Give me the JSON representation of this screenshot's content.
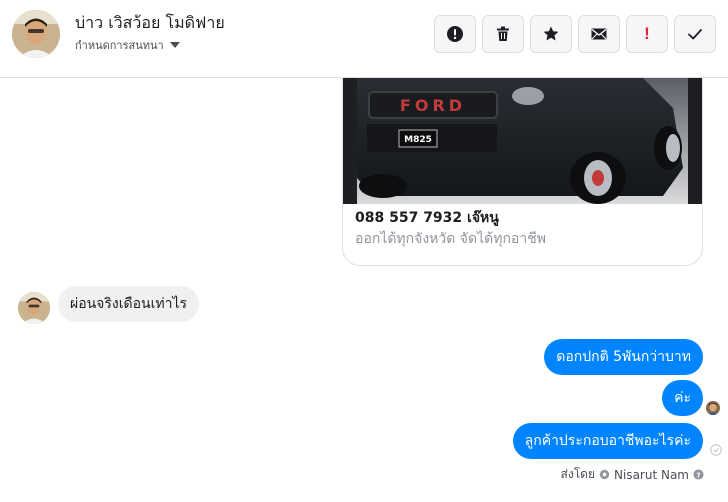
{
  "header": {
    "name": "บ่าว เวิสว้อย โมดิฟาย",
    "subtitle": "กำหนดการสนทนา",
    "actions": [
      {
        "name": "report-icon"
      },
      {
        "name": "trash-icon"
      },
      {
        "name": "star-icon"
      },
      {
        "name": "envelope-icon"
      },
      {
        "name": "important-icon",
        "label": "!"
      },
      {
        "name": "checkmark-icon"
      }
    ]
  },
  "conversation": {
    "card": {
      "title": "088 557 7932 เจ๊หนู",
      "description": "ออกได้ทุกจังหวัด จัดได้ทุกอาชีพ",
      "plate": "M825"
    },
    "messages": [
      {
        "direction": "in",
        "text": "ผ่อนจริงเดือนเท่าไร"
      },
      {
        "direction": "out",
        "text": "ดอกปกติ 5พันกว่าบาท"
      },
      {
        "direction": "out",
        "text": "ค่ะ"
      },
      {
        "direction": "out",
        "text": "ลูกค้าประกอบอาชีพอะไรค่ะ"
      }
    ],
    "sent_by": {
      "label": "ส่งโดย",
      "sender": "Nisarut Nam"
    }
  },
  "colors": {
    "outgoing_bubble": "#0084ff",
    "incoming_bubble": "#f1f0f0",
    "important": "#e41e3f"
  }
}
